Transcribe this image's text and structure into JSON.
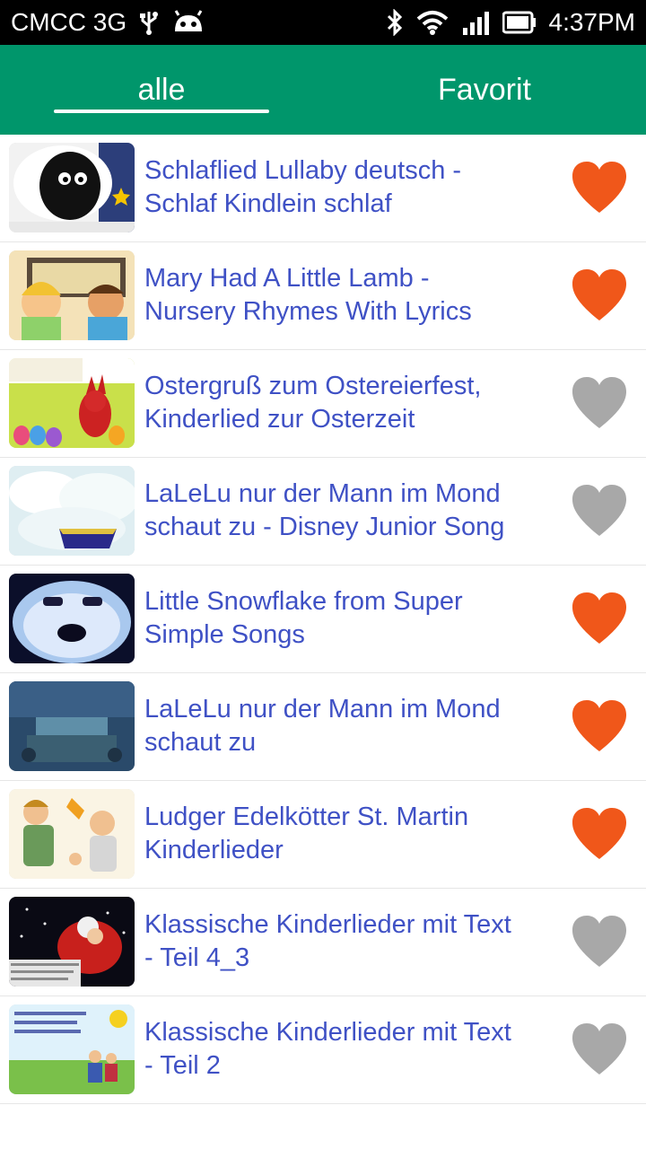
{
  "status_bar": {
    "carrier": "CMCC 3G",
    "time": "4:37PM",
    "icons": [
      "usb-icon",
      "android-icon",
      "bluetooth-icon",
      "wifi-icon",
      "signal-icon",
      "battery-icon"
    ]
  },
  "tabs": [
    {
      "label": "alle",
      "active": true
    },
    {
      "label": "Favorit",
      "active": false
    }
  ],
  "colors": {
    "accent": "#00966b",
    "title_text": "#3f51c5",
    "heart_favorite": "#f0571a",
    "heart_default": "#a8a8a8"
  },
  "items": [
    {
      "title_line1": "Schlaflied Lullaby deutsch -",
      "title_line2": "Schlaf Kindlein schlaf",
      "favorite": true
    },
    {
      "title_line1": "Mary Had A Little Lamb -",
      "title_line2": "Nursery Rhymes With Lyrics",
      "favorite": true
    },
    {
      "title_line1": "Ostergruß zum Ostereierfest,",
      "title_line2": "Kinderlied zur Osterzeit",
      "favorite": false
    },
    {
      "title_line1": "LaLeLu nur der Mann im Mond",
      "title_line2": "schaut zu - Disney Junior Song",
      "favorite": false
    },
    {
      "title_line1": "Little Snowflake from Super",
      "title_line2": "Simple Songs",
      "favorite": true
    },
    {
      "title_line1": "LaLeLu nur der Mann im Mond",
      "title_line2": "schaut zu",
      "favorite": true
    },
    {
      "title_line1": "Ludger Edelkötter St. Martin",
      "title_line2": "Kinderlieder",
      "favorite": true
    },
    {
      "title_line1": "Klassische Kinderlieder mit Text",
      "title_line2": "- Teil 4_3",
      "favorite": false
    },
    {
      "title_line1": "Klassische Kinderlieder mit Text",
      "title_line2": "- Teil 2",
      "favorite": false
    }
  ]
}
